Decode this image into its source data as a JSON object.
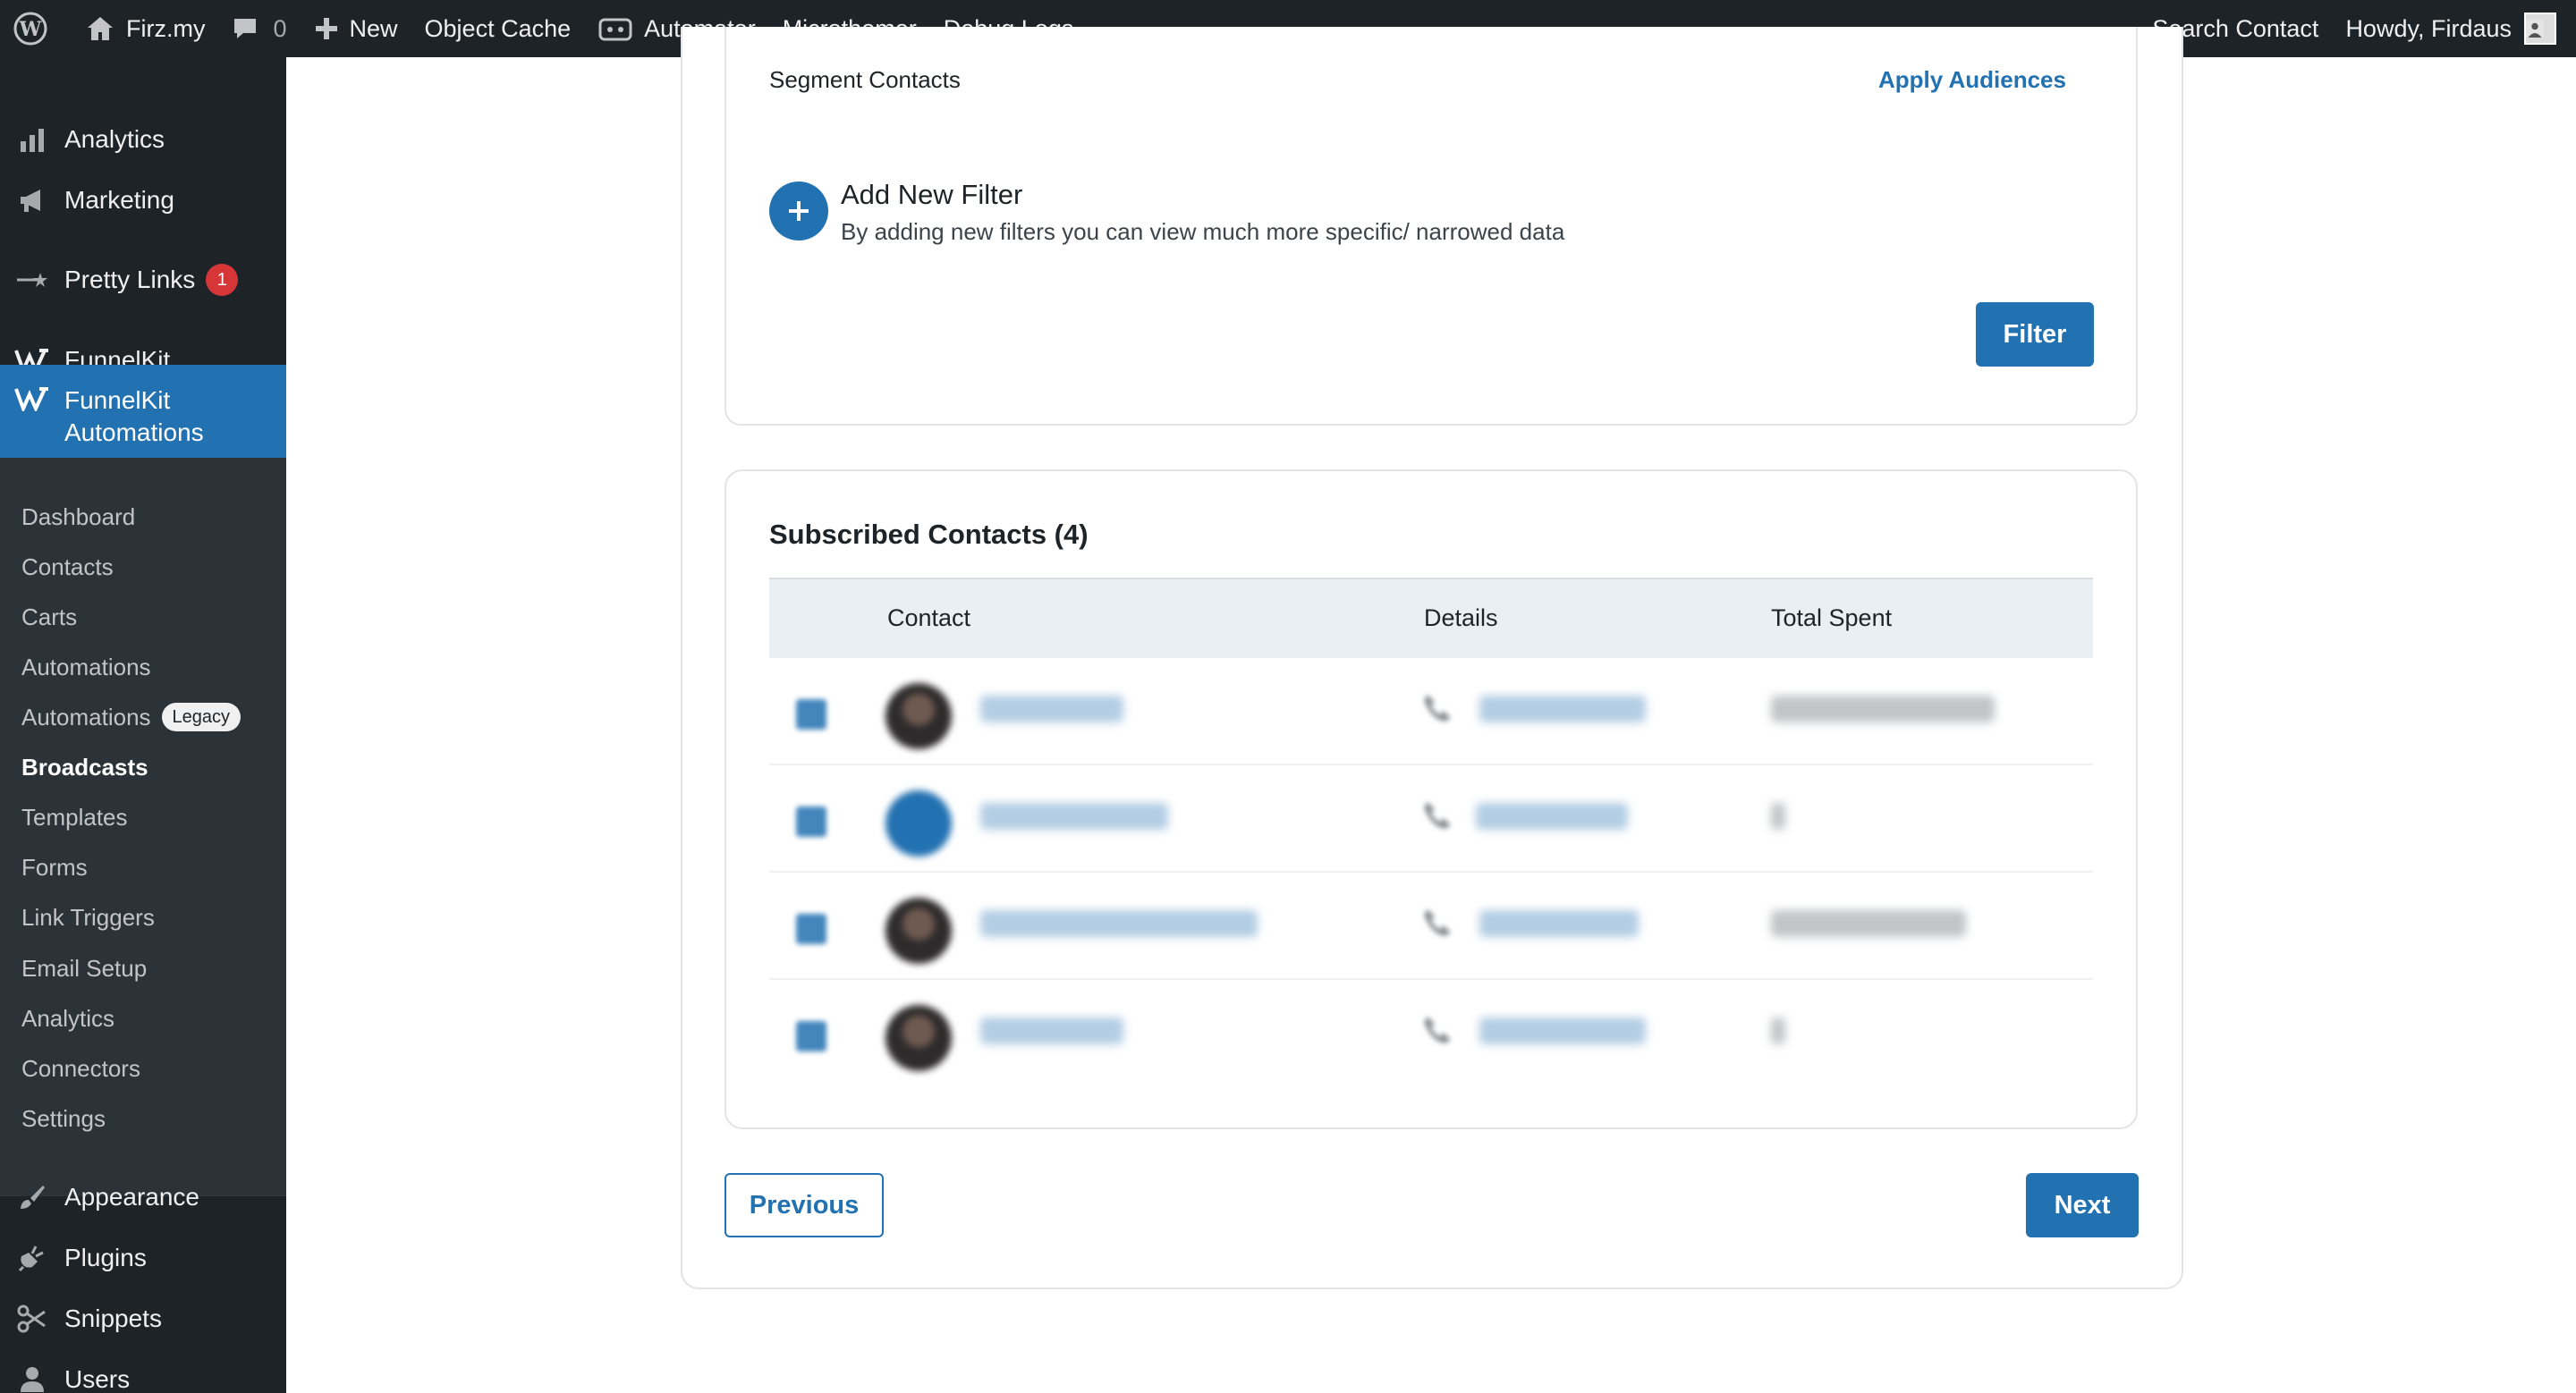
{
  "adminbar": {
    "site_name": "Firz.my",
    "comments_count": "0",
    "new_label": "New",
    "object_cache": "Object Cache",
    "automator": "Automator",
    "microthemer": "Microthemer",
    "debug_logs": "Debug Logs",
    "search_contact": "Search Contact",
    "howdy": "Howdy, Firdaus"
  },
  "sidebar": {
    "analytics": "Analytics",
    "marketing": "Marketing",
    "pretty_links": "Pretty Links",
    "pretty_links_badge": "1",
    "funnelkit": "FunnelKit",
    "funnelkit_automations": "FunnelKit Automations",
    "submenu": [
      "Dashboard",
      "Contacts",
      "Carts",
      "Automations",
      "Automations",
      "Broadcasts",
      "Templates",
      "Forms",
      "Link Triggers",
      "Email Setup",
      "Analytics",
      "Connectors",
      "Settings"
    ],
    "legacy_badge": "Legacy",
    "appearance": "Appearance",
    "plugins": "Plugins",
    "snippets": "Snippets",
    "users": "Users"
  },
  "filter_section": {
    "segment_label": "Segment Contacts",
    "apply_audiences": "Apply Audiences",
    "add_filter_title": "Add New Filter",
    "add_filter_desc": "By adding new filters you can view much more specific/ narrowed data",
    "filter_button": "Filter"
  },
  "contacts": {
    "title": "Subscribed Contacts (4)",
    "columns": [
      "Contact",
      "Details",
      "Total Spent"
    ]
  },
  "footer": {
    "previous": "Previous",
    "next": "Next"
  },
  "colors": {
    "accent": "#2271b1",
    "adminbar": "#1d2327",
    "submenu_bg": "#2c3338",
    "badge": "#d63638"
  }
}
